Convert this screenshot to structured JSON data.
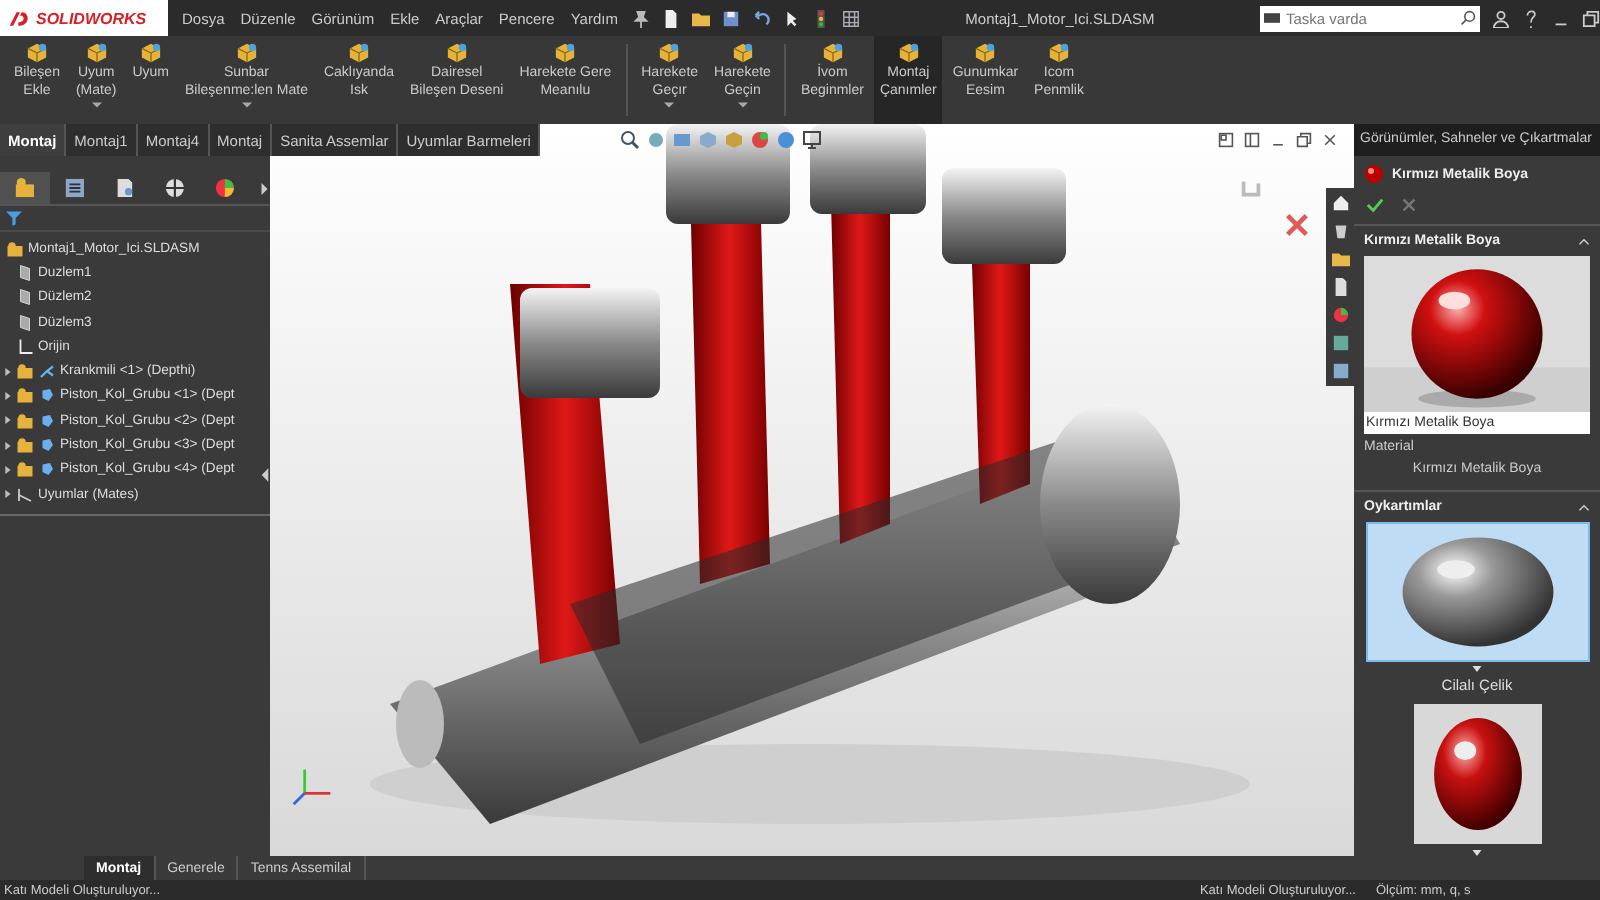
{
  "app": {
    "logo": "SOLIDWORKS"
  },
  "menu": [
    "Dosya",
    "Düzenle",
    "Görünüm",
    "Ekle",
    "Araçlar",
    "Pencere",
    "Yardım"
  ],
  "window": {
    "title": "Montaj1_Motor_Ici.SLDASM"
  },
  "search": {
    "placeholder": "Taska varda"
  },
  "ribbon": {
    "groups": [
      {
        "buttons": [
          {
            "lines": [
              "Bileşen",
              "Ekle"
            ],
            "dropdown": false,
            "selected": false
          },
          {
            "lines": [
              "Uyum",
              "(Mate)"
            ],
            "dropdown": true,
            "selected": false
          },
          {
            "lines": [
              "Uyum"
            ],
            "dropdown": false,
            "selected": false
          },
          {
            "lines": [
              "Sunbar",
              "Bileşenme:len Mate"
            ],
            "dropdown": true,
            "selected": false
          },
          {
            "lines": [
              "Caklıyanda",
              "Isk"
            ],
            "dropdown": false,
            "selected": false
          },
          {
            "lines": [
              "Dairesel",
              "Bileşen Deseni"
            ],
            "dropdown": false,
            "selected": false
          },
          {
            "lines": [
              "Harekete Gere",
              "Meanılu"
            ],
            "dropdown": false,
            "selected": false
          }
        ]
      },
      {
        "buttons": [
          {
            "lines": [
              "Harekete",
              "Geçır"
            ],
            "dropdown": true,
            "selected": false
          },
          {
            "lines": [
              "Harekete",
              "Geçin"
            ],
            "dropdown": true,
            "selected": false
          }
        ]
      },
      {
        "buttons": [
          {
            "lines": [
              "İvom",
              "Beginmler"
            ],
            "dropdown": false,
            "selected": false
          },
          {
            "lines": [
              "Montaj",
              "Çanımler"
            ],
            "dropdown": false,
            "selected": true
          },
          {
            "lines": [
              "Gunumkar",
              "Eesim"
            ],
            "dropdown": false,
            "selected": false
          },
          {
            "lines": [
              "Icom",
              "Penmlik"
            ],
            "dropdown": false,
            "selected": false
          }
        ]
      }
    ]
  },
  "command_tabs": [
    {
      "label": "Montaj",
      "selected": true
    },
    {
      "label": "Montaj1",
      "selected": false
    },
    {
      "label": "Montaj4",
      "selected": false
    },
    {
      "label": "Montaj",
      "selected": false
    },
    {
      "label": "Sanita Assemlar",
      "selected": false
    },
    {
      "label": "Uyumlar Barmeleri",
      "selected": false
    }
  ],
  "tree": {
    "label": "Montaj1_Motor_Ici.SLDASM",
    "children": [
      {
        "kind": "plane",
        "label": "Duzlem1"
      },
      {
        "kind": "plane",
        "label": "Düzlem2"
      },
      {
        "kind": "plane",
        "label": "Düzlem3"
      },
      {
        "kind": "origin",
        "label": "Orijin"
      },
      {
        "kind": "part",
        "label": "Krankmili <1> (Depthi)",
        "expanded": false
      },
      {
        "kind": "subassembly",
        "label": "Piston_Kol_Grubu <1> (Dept",
        "expanded": false
      },
      {
        "kind": "subassembly",
        "label": "Piston_Kol_Grubu <2> (Dept",
        "expanded": false
      },
      {
        "kind": "subassembly",
        "label": "Piston_Kol_Grubu <3> (Dept",
        "expanded": false
      },
      {
        "kind": "subassembly",
        "label": "Piston_Kol_Grubu <4> (Dept",
        "expanded": false
      },
      {
        "kind": "mates",
        "label": "Uyumlar (Mates)",
        "expanded": false
      }
    ]
  },
  "task_pane": {
    "title": "Görünümler, Sahneler ve Çıkartmalar",
    "appearance": "Kırmızı Metalik Boya",
    "section": {
      "title": "Kırmızı Metalik Boya",
      "caption": "Kırmızı Metalik Boya",
      "material_label": "Material",
      "material": "Kırmızı Metalik Boya"
    },
    "swatches": {
      "title": "Oykartımlar",
      "items": [
        {
          "label": "Cilalı Çelik",
          "selected": true
        },
        {
          "selected": false
        }
      ]
    }
  },
  "sheet_tabs": [
    {
      "label": "Montaj",
      "selected": true
    },
    {
      "label": "Generele",
      "selected": false
    },
    {
      "label": "Tenns Assemilal",
      "selected": false
    }
  ],
  "status_bar": {
    "left": "Katı Modeli Oluşturuluyor...",
    "right": "Katı Modeli Oluşturuluyor...",
    "units": "Ölçüm: mm, q, s"
  }
}
